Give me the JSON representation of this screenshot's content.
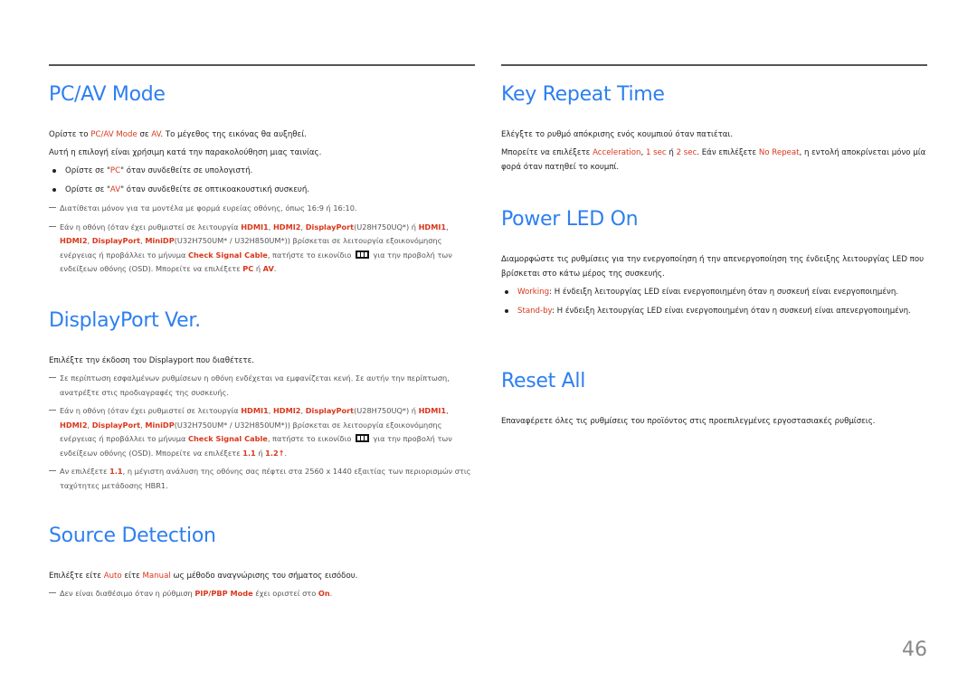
{
  "page_number": "46",
  "colors": {
    "heading": "#2d7ff0",
    "highlight": "#d9371b",
    "text": "#222222",
    "note": "#555555"
  },
  "left": {
    "pc_av_mode": {
      "title": "PC/AV Mode",
      "p1": [
        "Ορίστε το ",
        "PC/AV Mode",
        " σε ",
        "AV",
        ". Το μέγεθος της εικόνας θα αυξηθεί."
      ],
      "p2": "Αυτή η επιλογή είναι χρήσιμη κατά την παρακολούθηση μιας ταινίας.",
      "bullets": [
        [
          "Ορίστε σε \"",
          "PC",
          "\" όταν συνδεθείτε σε υπολογιστή."
        ],
        [
          "Ορίστε σε \"",
          "AV",
          "\" όταν συνδεθείτε σε οπτικοακουστική συσκευή."
        ]
      ],
      "note1": "Διατίθεται μόνον για τα μοντέλα με φορμά ευρείας οθόνης, όπως 16:9 ή 16:10.",
      "note2": {
        "t1": "Εάν η οθόνη (όταν έχει ρυθμιστεί σε λειτουργία ",
        "hdmi1": "HDMI1",
        "sep1": ", ",
        "hdmi2": "HDMI2",
        "sep2": ", ",
        "dp": "DisplayPort",
        "t2": "(U28H750UQ*) ή ",
        "hdmi1b": "HDMI1",
        "sep3": ", ",
        "hdmi2b": "HDMI2",
        "sep4": ", ",
        "dpb": "DisplayPort",
        "sep5": ", ",
        "minidp": "MiniDP",
        "t3": "(U32H750UM* / U32H850UM*)) βρίσκεται σε λειτουργία εξοικονόμησης ενέργειας ή προβάλλει το μήνυμα ",
        "csc": "Check Signal Cable",
        "t4": ", πατήστε το εικονίδιο ",
        "icon": "menu-icon",
        "t5": " για την προβολή των ενδείξεων οθόνης (OSD). Μπορείτε να επιλέξετε ",
        "opt1": "PC",
        "or": " ή ",
        "opt2": "AV",
        "end": "."
      }
    },
    "displayport_ver": {
      "title": "DisplayPort Ver.",
      "p1": "Επιλέξτε την έκδοση του Displayport που διαθέτετε.",
      "note1": "Σε περίπτωση εσφαλμένων ρυθμίσεων η οθόνη ενδέχεται να εμφανίζεται κενή. Σε αυτήν την περίπτωση, ανατρέξτε στις προδιαγραφές της συσκευής.",
      "note2": {
        "t1": "Εάν η οθόνη (όταν έχει ρυθμιστεί σε λειτουργία ",
        "hdmi1": "HDMI1",
        "sep1": ", ",
        "hdmi2": "HDMI2",
        "sep2": ", ",
        "dp": "DisplayPort",
        "t2": "(U28H750UQ*) ή ",
        "hdmi1b": "HDMI1",
        "sep3": ", ",
        "hdmi2b": "HDMI2",
        "sep4": ", ",
        "dpb": "DisplayPort",
        "sep5": ", ",
        "minidp": "MiniDP",
        "t3": "(U32H750UM* / U32H850UM*)) βρίσκεται σε λειτουργία εξοικονόμησης ενέργειας ή προβάλλει το μήνυμα ",
        "csc": "Check Signal Cable",
        "t4": ", πατήστε το εικονίδιο ",
        "icon": "menu-icon",
        "t5": " για την προβολή των ενδείξεων οθόνης (OSD). Μπορείτε να επιλέξετε ",
        "opt1": "1.1",
        "or": " ή ",
        "opt2": "1.2↑",
        "end": "."
      },
      "note3": [
        "Αν επιλέξετε ",
        "1.1",
        ", η μέγιστη ανάλυση της οθόνης σας πέφτει στα 2560 x 1440 εξαιτίας των περιορισμών στις ταχύτητες μετάδοσης HBR1."
      ]
    },
    "source_detection": {
      "title": "Source Detection",
      "p1": [
        "Επιλέξτε είτε ",
        "Auto",
        " είτε ",
        "Manual",
        " ως μέθοδο αναγνώρισης του σήματος εισόδου."
      ],
      "note1": [
        "Δεν είναι διαθέσιμο όταν η ρύθμιση ",
        "PIP/PBP Mode",
        " έχει οριστεί στο ",
        "On",
        "."
      ]
    }
  },
  "right": {
    "key_repeat_time": {
      "title": "Key Repeat Time",
      "p1": "Ελέγξτε το ρυθμό απόκρισης ενός κουμπιού όταν πατιέται.",
      "p2": [
        "Μπορείτε να επιλέξετε ",
        "Acceleration",
        ", ",
        "1 sec",
        " ή ",
        "2 sec",
        ". Εάν επιλέξετε ",
        "No Repeat",
        ", η εντολή αποκρίνεται μόνο μία φορά όταν πατηθεί το κουμπί."
      ]
    },
    "power_led_on": {
      "title": "Power LED On",
      "p1": "Διαμορφώστε τις ρυθμίσεις για την ενεργοποίηση ή την απενεργοποίηση της ένδειξης λειτουργίας LED που βρίσκεται στο κάτω μέρος της συσκευής.",
      "bullets": [
        [
          "Working",
          ": Η ένδειξη λειτουργίας LED είναι ενεργοποιημένη όταν η συσκευή είναι ενεργοποιημένη."
        ],
        [
          "Stand-by",
          ": Η ένδειξη λειτουργίας LED είναι ενεργοποιημένη όταν η συσκευή είναι απενεργοποιημένη."
        ]
      ]
    },
    "reset_all": {
      "title": "Reset All",
      "p1": "Επαναφέρετε όλες τις ρυθμίσεις του προϊόντος στις προεπιλεγμένες εργοστασιακές ρυθμίσεις."
    }
  }
}
